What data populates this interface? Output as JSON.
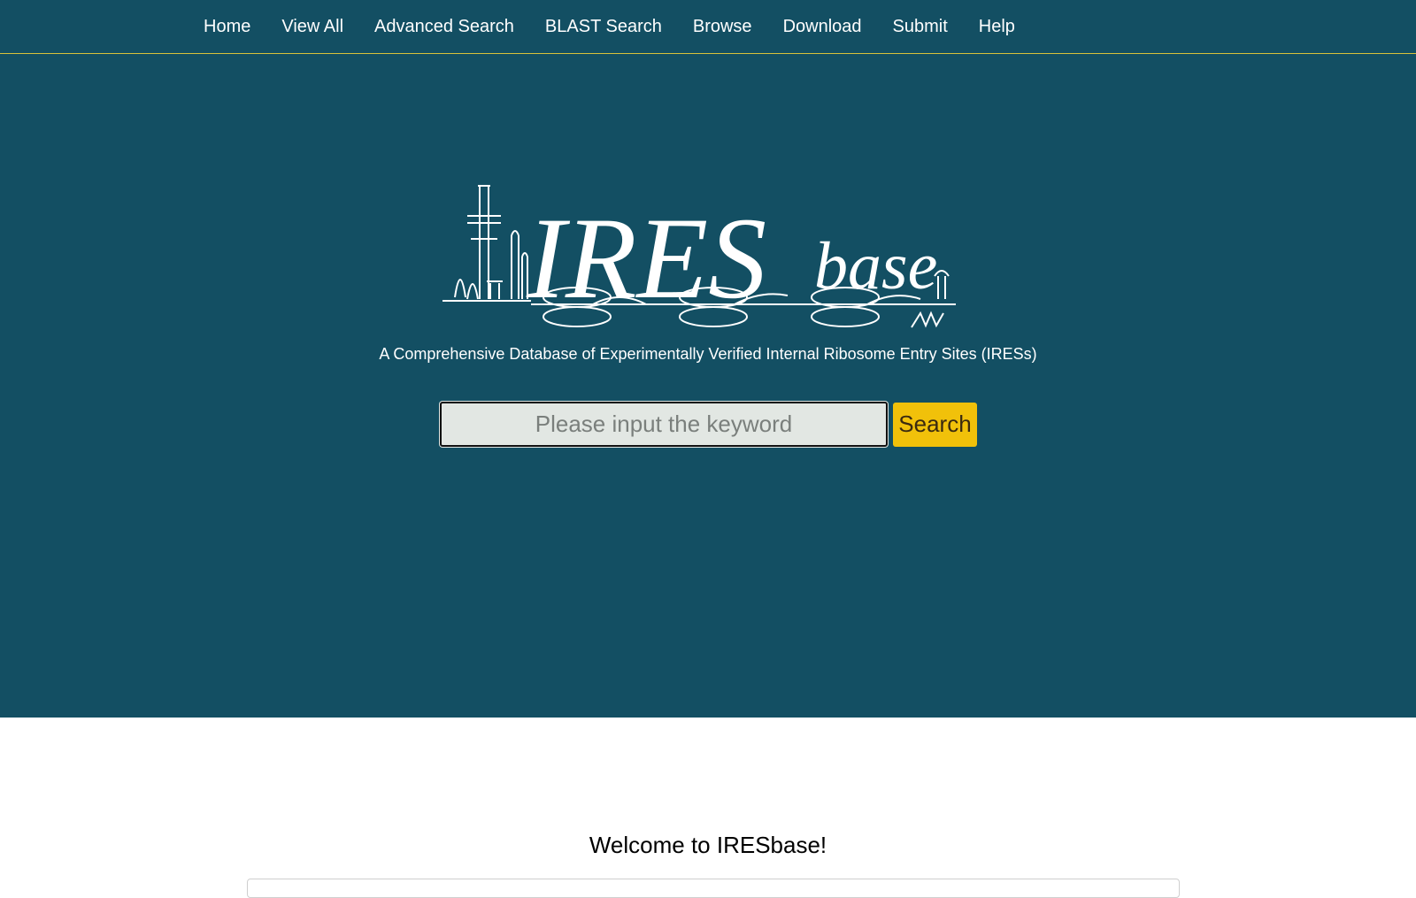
{
  "nav": {
    "items": [
      "Home",
      "View All",
      "Advanced Search",
      "BLAST Search",
      "Browse",
      "Download",
      "Submit",
      "Help"
    ]
  },
  "logo": {
    "text_main": "IRES",
    "text_sub": "base",
    "color": "#ffffff"
  },
  "hero": {
    "tagline": "A Comprehensive Database of Experimentally Verified Internal Ribosome Entry Sites (IRESs)",
    "background": "#134f63"
  },
  "search": {
    "placeholder": "Please input the keyword",
    "value": "",
    "button_label": "Search",
    "button_color": "#f1c10a"
  },
  "main": {
    "welcome": "Welcome to IRESbase!"
  }
}
